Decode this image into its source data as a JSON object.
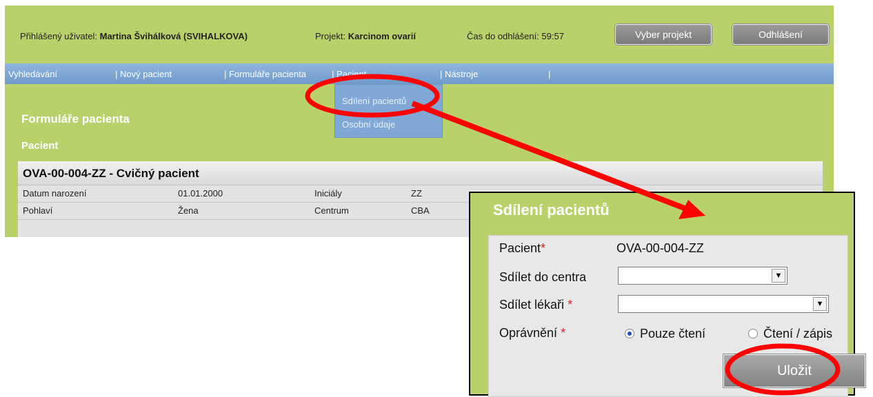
{
  "topbar": {
    "user_label": "Přihlášený uživatel:",
    "user_name": "Martina Švihálková (SVIHALKOVA)",
    "project_label": "Projekt:",
    "project_name": "Karcinom ovarií",
    "timeout_label": "Čas do odhlášení:",
    "timeout_value": "59:57",
    "select_project_label": "Vyber projekt",
    "logout_label": "Odhlášení"
  },
  "navbar": {
    "items": [
      {
        "label": "Vyhledávání"
      },
      {
        "label": "| Nový pacient"
      },
      {
        "label": "| Formuláře pacienta"
      },
      {
        "label": "| Pacient"
      },
      {
        "label": "| Nástroje"
      },
      {
        "label": "|"
      }
    ],
    "dropdown": [
      "Sdílení pacientů",
      "Osobní údaje"
    ]
  },
  "page": {
    "title": "Formuláře pacienta",
    "section": "Pacient"
  },
  "patient": {
    "heading": "OVA-00-004-ZZ - Cvičný pacient",
    "rows": [
      {
        "label1": "Datum narození",
        "value1": "01.01.2000",
        "label2": "Iniciály",
        "value2": "ZZ"
      },
      {
        "label1": "Pohlaví",
        "value1": "Žena",
        "label2": "Centrum",
        "value2": "CBA"
      }
    ]
  },
  "dialog": {
    "title": "Sdílení pacientů",
    "patient_label": "Pacient",
    "patient_value": "OVA-00-004-ZZ",
    "center_label": "Sdílet do centra",
    "doctor_label": "Sdílet lékaři",
    "permission_label": "Oprávnění",
    "required_mark": "*",
    "radio_read": "Pouze čtení",
    "radio_readwrite": "Čtení / zápis",
    "selected_permission": "Pouze čtení",
    "save_label": "Uložit"
  },
  "annotation": {
    "color": "#ff0000"
  }
}
